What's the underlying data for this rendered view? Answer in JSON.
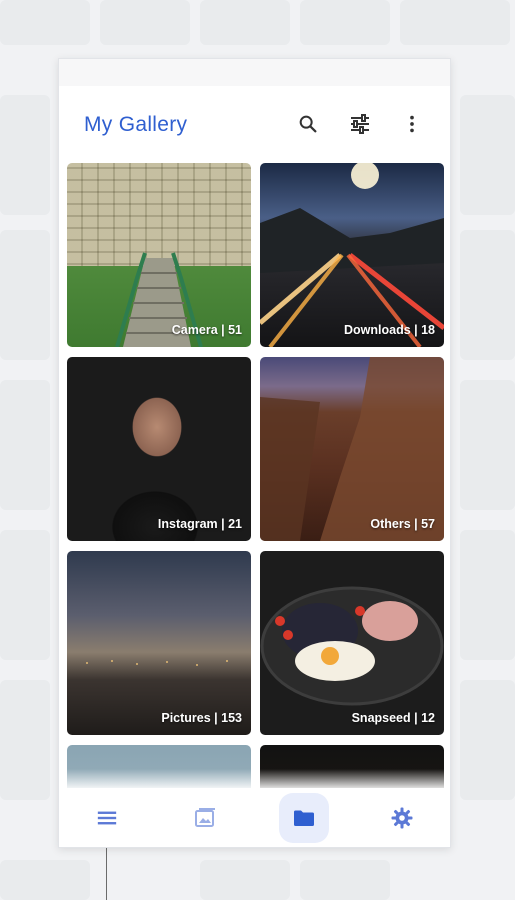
{
  "app": {
    "title": "My Gallery"
  },
  "colors": {
    "accent": "#2f5fd0",
    "icon": "#333333",
    "nav_active_bg": "#e8edfb",
    "nav_icon": "#5c79d6"
  },
  "toolbar": {
    "icons": [
      "search-icon",
      "tune-icon",
      "more-vert-icon"
    ]
  },
  "albums": [
    {
      "name": "Camera",
      "count": 51,
      "label": "Camera | 51"
    },
    {
      "name": "Downloads",
      "count": 18,
      "label": "Downloads | 18"
    },
    {
      "name": "Instagram",
      "count": 21,
      "label": "Instagram | 21"
    },
    {
      "name": "Others",
      "count": 57,
      "label": "Others | 57"
    },
    {
      "name": "Pictures",
      "count": 153,
      "label": "Pictures | 153"
    },
    {
      "name": "Snapseed",
      "count": 12,
      "label": "Snapseed | 12"
    }
  ],
  "bottom_nav": [
    {
      "icon": "menu-icon",
      "active": false
    },
    {
      "icon": "photos-icon",
      "active": false
    },
    {
      "icon": "folder-icon",
      "active": true
    },
    {
      "icon": "settings-icon",
      "active": false
    }
  ]
}
